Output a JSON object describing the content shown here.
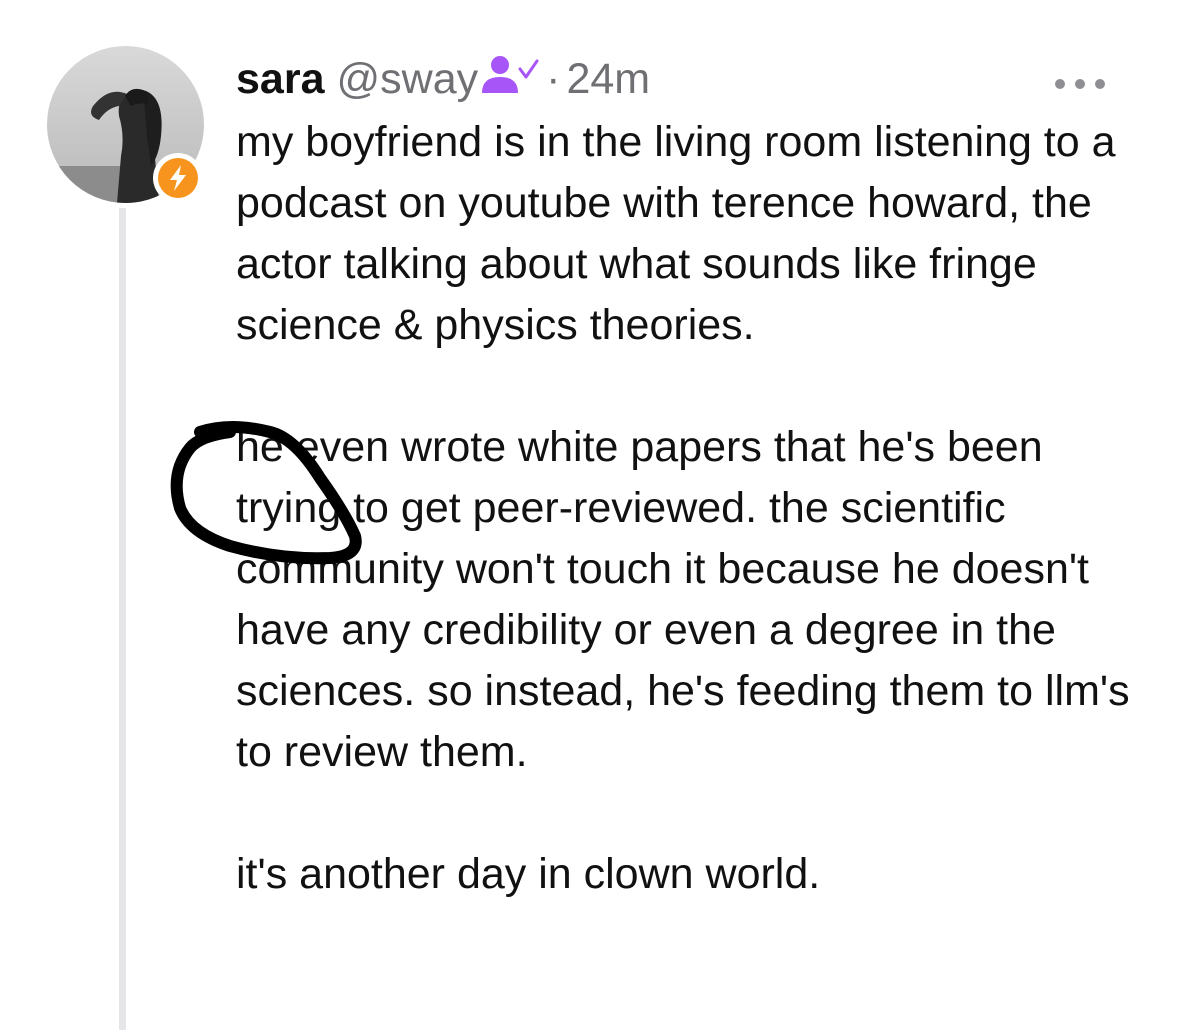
{
  "post": {
    "author": {
      "display_name": "sara",
      "handle": "@sway",
      "avatar_icon": "avatar-photo",
      "badge_icon": "lightning-bolt-icon",
      "badge_color": "#f7941d",
      "verified_icon": "user-check-icon",
      "verified_color": "#a855f7"
    },
    "separator": "·",
    "timestamp": "24m",
    "more_icon": "ellipsis-icon",
    "paragraphs": [
      "my boyfriend is in the living room listening to a podcast on youtube with terence howard, the actor talking about what sounds like fringe science & physics theories.",
      "he even wrote white papers that he's been trying to get peer-reviewed. the scientific community won't touch it because he doesn't have any credibility or even a degree in the sciences. so instead, he's feeding them to llm's to review them.",
      "it's another day in clown world."
    ]
  },
  "annotation": {
    "icon": "hand-drawn-circle",
    "color": "#000000"
  }
}
